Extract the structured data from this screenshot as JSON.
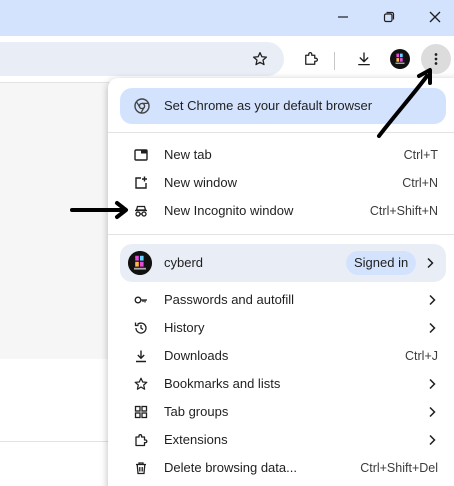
{
  "window": {
    "minimize_icon": "minimize-icon",
    "restore_icon": "restore-icon",
    "close_icon": "close-icon"
  },
  "toolbar": {
    "bookmark_icon": "star-icon",
    "extensions_icon": "puzzle-icon",
    "downloads_icon": "download-icon",
    "profile_icon": "avatar",
    "menu_icon": "kebab-menu-icon"
  },
  "menu": {
    "default_browser": {
      "label": "Set Chrome as your default browser",
      "icon": "chrome-icon"
    },
    "section1": [
      {
        "label": "New tab",
        "shortcut": "Ctrl+T",
        "icon": "new-tab-icon"
      },
      {
        "label": "New window",
        "shortcut": "Ctrl+N",
        "icon": "new-window-icon"
      },
      {
        "label": "New Incognito window",
        "shortcut": "Ctrl+Shift+N",
        "icon": "incognito-icon"
      }
    ],
    "profile": {
      "name": "cyberd",
      "status": "Signed in"
    },
    "section2": [
      {
        "label": "Passwords and autofill",
        "icon": "key-icon"
      },
      {
        "label": "History",
        "icon": "history-icon"
      },
      {
        "label": "Downloads",
        "shortcut": "Ctrl+J",
        "icon": "download-icon"
      },
      {
        "label": "Bookmarks and lists",
        "icon": "star-icon"
      },
      {
        "label": "Tab groups",
        "icon": "tab-groups-icon"
      },
      {
        "label": "Extensions",
        "icon": "puzzle-icon"
      },
      {
        "label": "Delete browsing data...",
        "shortcut": "Ctrl+Shift+Del",
        "icon": "trash-icon"
      }
    ]
  },
  "colors": {
    "titlebar": "#d3e3fd",
    "banner": "#d3e3fd",
    "profile_bg": "#e9eef6",
    "annotation_arrow": "#000000"
  }
}
